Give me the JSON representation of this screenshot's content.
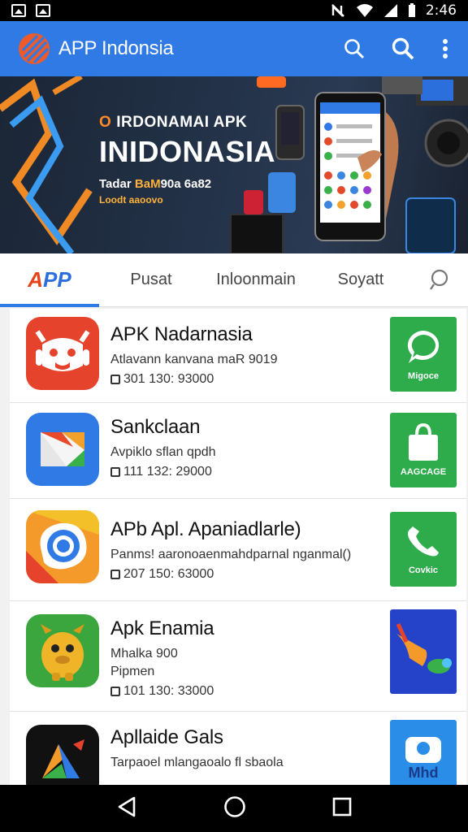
{
  "status_bar": {
    "time": "2:46"
  },
  "app_bar": {
    "title": "APP Indonsia"
  },
  "banner": {
    "kicker": "IRDONAMAI APK",
    "kicker_mark": "O",
    "title": "INIDONASIA",
    "subtitle_prefix": "Tadar ",
    "subtitle_highlight": "BaM",
    "subtitle_suffix": "90a 6a82",
    "subtitle2": "Loodt aaoovo"
  },
  "tabs": [
    {
      "label_a": "A",
      "label_b": "PP"
    },
    {
      "label": "Pusat"
    },
    {
      "label": "Inloonmain"
    },
    {
      "label": "Soyatt"
    }
  ],
  "apps": [
    {
      "name": "APK Nadarnasia",
      "desc": "Atlavann kanvana maR 9019",
      "meta": "301 130: 93000",
      "action": "Migoce",
      "icon_color": "#e5432b",
      "action_color": "#2eab4b"
    },
    {
      "name": "Sankclaan",
      "desc": "Avpiklo sflan qpdh",
      "meta": "111 132: 29000",
      "action": "AAGCAGE",
      "icon_color": "#2f7ae5",
      "action_color": "#2eab4b"
    },
    {
      "name": "APb Apl. Apaniadlarle)",
      "desc": "Panms! aaronoaenmahdparnal nganmal()",
      "meta": "207 150: 63000",
      "action": "Covkic",
      "icon_color": "#f39a2a",
      "action_color": "#2eab4b"
    },
    {
      "name": "Apk Enamia",
      "desc": "Mhalka 900",
      "desc2": "Pipmen",
      "meta": "101 130: 33000",
      "action": "",
      "icon_color": "#3aa63d",
      "action_color": "#2443c9"
    },
    {
      "name": "Apllaide Gals",
      "desc": "Tarpaoel mlangaoalo fl sbaola",
      "meta": "",
      "action": "Mhd",
      "icon_color": "#111111",
      "action_color": "#2a8de8"
    }
  ]
}
